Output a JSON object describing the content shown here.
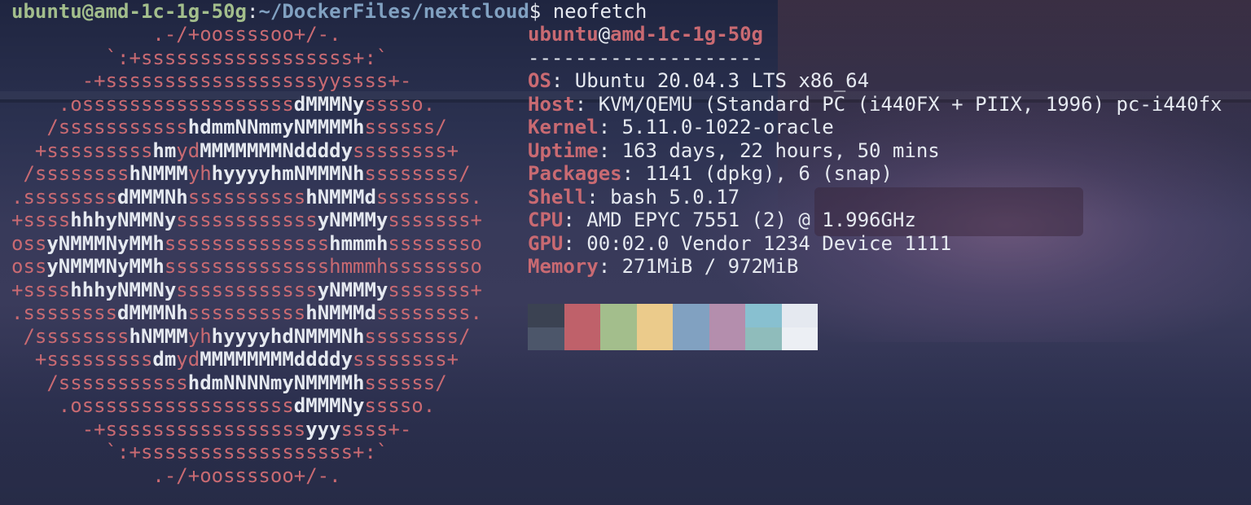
{
  "prompt": {
    "user_host": "ubuntu@amd-1c-1g-50g",
    "colon": ":",
    "path": "~/DockerFiles/nextcloud",
    "symbol": "$",
    "command": "neofetch"
  },
  "logo_lines": [
    [
      {
        "t": "            .-/+oossssoo+/-."
      }
    ],
    [
      {
        "t": "        `:+ssssssssssssssssss+:`"
      }
    ],
    [
      {
        "t": "      -+ssssssssssssssssssyyssss+-"
      }
    ],
    [
      {
        "t": "    .ossssssssssssssssss"
      },
      {
        "t": "dMMMNy",
        "b": true
      },
      {
        "t": "sssso."
      }
    ],
    [
      {
        "t": "   /sssssssssss"
      },
      {
        "t": "hdmmNNmmyNMMMMh",
        "b": true
      },
      {
        "t": "ssssss/"
      }
    ],
    [
      {
        "t": "  +sssssssss"
      },
      {
        "t": "hm",
        "b": true
      },
      {
        "t": "yd"
      },
      {
        "t": "MMMMMMMNddddy",
        "b": true
      },
      {
        "t": "ssssssss+"
      }
    ],
    [
      {
        "t": " /ssssssss"
      },
      {
        "t": "hNMMM",
        "b": true
      },
      {
        "t": "yh"
      },
      {
        "t": "hyyyyhmNMMMNh",
        "b": true
      },
      {
        "t": "ssssssss/"
      }
    ],
    [
      {
        "t": ".ssssssss"
      },
      {
        "t": "dMMMNh",
        "b": true
      },
      {
        "t": "ssssssssss"
      },
      {
        "t": "hNMMMd",
        "b": true
      },
      {
        "t": "ssssssss."
      }
    ],
    [
      {
        "t": "+ssss"
      },
      {
        "t": "hhhyNMMNy",
        "b": true
      },
      {
        "t": "ssssssssssss"
      },
      {
        "t": "yNMMMy",
        "b": true
      },
      {
        "t": "sssssss+"
      }
    ],
    [
      {
        "t": "oss"
      },
      {
        "t": "yNMMMNyMMh",
        "b": true
      },
      {
        "t": "ssssssssssssss"
      },
      {
        "t": "hmmmh",
        "b": true
      },
      {
        "t": "ssssssso"
      }
    ],
    [
      {
        "t": "oss"
      },
      {
        "t": "yNMMMNyMMh",
        "b": true
      },
      {
        "t": "sssssssssssssshmmmhssssssso"
      }
    ],
    [
      {
        "t": "+ssss"
      },
      {
        "t": "hhhyNMMNy",
        "b": true
      },
      {
        "t": "ssssssssssss"
      },
      {
        "t": "yNMMMy",
        "b": true
      },
      {
        "t": "sssssss+"
      }
    ],
    [
      {
        "t": ".ssssssss"
      },
      {
        "t": "dMMMNh",
        "b": true
      },
      {
        "t": "ssssssssss"
      },
      {
        "t": "hNMMMd",
        "b": true
      },
      {
        "t": "ssssssss."
      }
    ],
    [
      {
        "t": " /ssssssss"
      },
      {
        "t": "hNMMM",
        "b": true
      },
      {
        "t": "yh"
      },
      {
        "t": "hyyyyhdNMMMNh",
        "b": true
      },
      {
        "t": "ssssssss/"
      }
    ],
    [
      {
        "t": "  +sssssssss"
      },
      {
        "t": "dm",
        "b": true
      },
      {
        "t": "yd"
      },
      {
        "t": "MMMMMMMMddddy",
        "b": true
      },
      {
        "t": "ssssssss+"
      }
    ],
    [
      {
        "t": "   /sssssssssss"
      },
      {
        "t": "hdmNNNNmyNMMMMh",
        "b": true
      },
      {
        "t": "ssssss/"
      }
    ],
    [
      {
        "t": "    .ossssssssssssssssss"
      },
      {
        "t": "dMMMNy",
        "b": true
      },
      {
        "t": "sssso."
      }
    ],
    [
      {
        "t": "      -+sssssssssssssssss"
      },
      {
        "t": "yyy",
        "b": true
      },
      {
        "t": "ssss+-"
      }
    ],
    [
      {
        "t": "        `:+ssssssssssssssssss+:`"
      }
    ],
    [
      {
        "t": "            .-/+oossssoo+/-."
      }
    ]
  ],
  "info": {
    "user": "ubuntu",
    "at": "@",
    "host": "amd-1c-1g-50g",
    "separator": "--------------------",
    "fields": [
      {
        "key": "OS",
        "value": ": Ubuntu 20.04.3 LTS x86_64"
      },
      {
        "key": "Host",
        "value": ": KVM/QEMU (Standard PC (i440FX + PIIX, 1996) pc-i440fx"
      },
      {
        "key": "Kernel",
        "value": ": 5.11.0-1022-oracle"
      },
      {
        "key": "Uptime",
        "value": ": 163 days, 22 hours, 50 mins"
      },
      {
        "key": "Packages",
        "value": ": 1141 (dpkg), 6 (snap)"
      },
      {
        "key": "Shell",
        "value": ": bash 5.0.17"
      },
      {
        "key": "CPU",
        "value": ": AMD EPYC 7551 (2) @ 1.996GHz"
      },
      {
        "key": "GPU",
        "value": ": 00:02.0 Vendor 1234 Device 1111"
      },
      {
        "key": "Memory",
        "value": ": 271MiB / 972MiB"
      }
    ]
  },
  "palette": {
    "normal": [
      "#3b4252",
      "#bf616a",
      "#a3be8c",
      "#ebcb8b",
      "#81a1c1",
      "#b48ead",
      "#88c0d0",
      "#e5e9f0"
    ],
    "bright": [
      "#4c566a",
      "#bf616a",
      "#a3be8c",
      "#ebcb8b",
      "#81a1c1",
      "#b48ead",
      "#8fbcbb",
      "#eceff4"
    ]
  }
}
